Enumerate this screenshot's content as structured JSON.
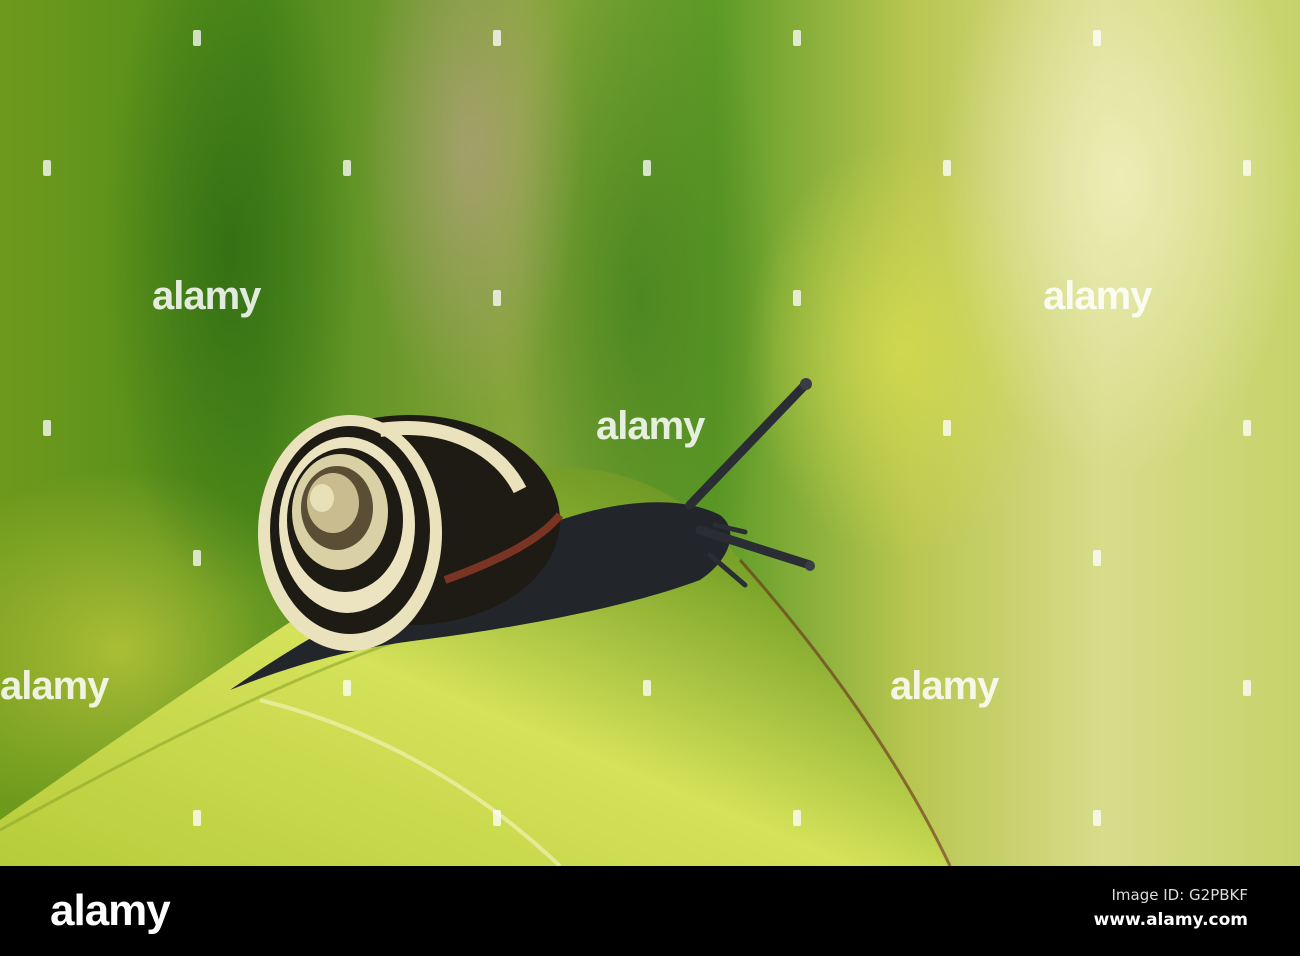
{
  "photo": {
    "subject": "snail on leaf",
    "watermark_text": "alamy"
  },
  "footer": {
    "logo": "alamy",
    "image_id": "Image ID: G2PBKF",
    "url": "www.alamy.com"
  }
}
